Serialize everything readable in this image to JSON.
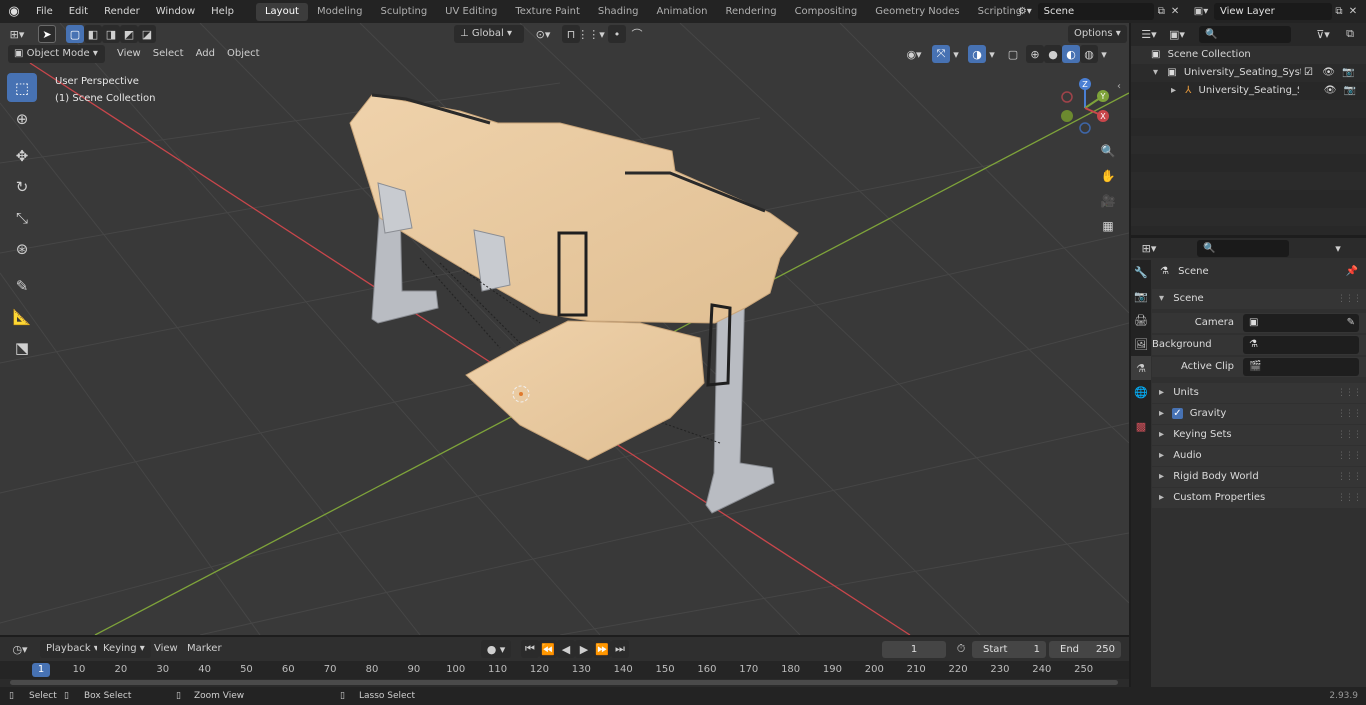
{
  "topbar": {
    "menus": [
      "File",
      "Edit",
      "Render",
      "Window",
      "Help"
    ],
    "workspaces": [
      "Layout",
      "Modeling",
      "Sculpting",
      "UV Editing",
      "Texture Paint",
      "Shading",
      "Animation",
      "Rendering",
      "Compositing",
      "Geometry Nodes",
      "Scripting"
    ],
    "active_workspace": "Layout",
    "add_workspace": "+",
    "scene_name": "Scene",
    "view_layer": "View Layer"
  },
  "viewport_header": {
    "mode": "Object Mode",
    "menus": [
      "View",
      "Select",
      "Add",
      "Object"
    ],
    "transform_orientation": "Global",
    "options": "Options"
  },
  "viewport_overlay": {
    "perspective": "User Perspective",
    "collection": "(1) Scene Collection"
  },
  "gizmo": {
    "z": "Z",
    "y": "Y",
    "x": "X"
  },
  "outliner": {
    "root": "Scene Collection",
    "items": [
      {
        "label": "University_Seating_System_F",
        "level": 1
      },
      {
        "label": "University_Seating_Syste",
        "level": 2
      }
    ]
  },
  "properties": {
    "breadcrumb": "Scene",
    "section": "Scene",
    "fields": [
      {
        "label": "Camera",
        "value": ""
      },
      {
        "label": "Background Scene",
        "value": ""
      },
      {
        "label": "Active Clip",
        "value": ""
      }
    ],
    "panels": [
      {
        "label": "Units",
        "checkbox": false
      },
      {
        "label": "Gravity",
        "checkbox": true
      },
      {
        "label": "Keying Sets",
        "checkbox": false
      },
      {
        "label": "Audio",
        "checkbox": false
      },
      {
        "label": "Rigid Body World",
        "checkbox": false
      },
      {
        "label": "Custom Properties",
        "checkbox": false
      }
    ]
  },
  "timeline": {
    "menus": [
      "Playback",
      "Keying",
      "View",
      "Marker"
    ],
    "current_frame": "1",
    "start_label": "Start",
    "start": "1",
    "end_label": "End",
    "end": "250",
    "ticks": [
      "1",
      "10",
      "20",
      "30",
      "40",
      "50",
      "60",
      "70",
      "80",
      "90",
      "100",
      "110",
      "120",
      "130",
      "140",
      "150",
      "160",
      "170",
      "180",
      "190",
      "200",
      "210",
      "220",
      "230",
      "240",
      "250"
    ]
  },
  "statusbar": {
    "select": "Select",
    "box_select": "Box Select",
    "zoom_view": "Zoom View",
    "lasso_select": "Lasso Select",
    "version": "2.93.9"
  },
  "colors": {
    "accent": "#4772b3",
    "viewport_bg": "#393939",
    "wood": "#e8c9a1",
    "metal": "#b9bcc2",
    "x_axis": "#c8464b",
    "y_axis": "#7ea33a"
  }
}
